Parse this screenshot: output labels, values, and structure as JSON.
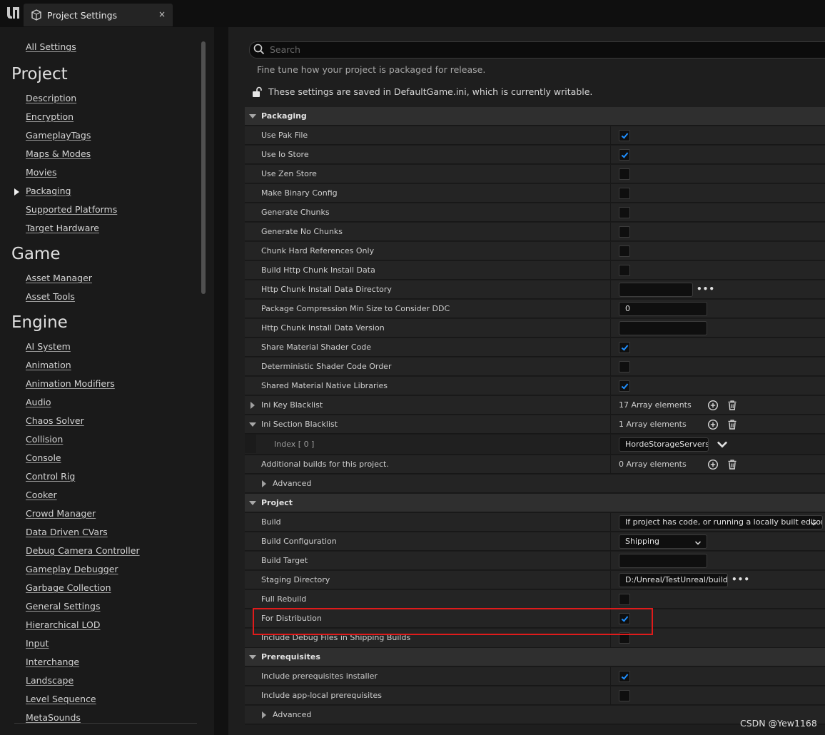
{
  "window": {
    "tab_title": "Project Settings",
    "close_glyph": "×"
  },
  "nav": {
    "all_settings": "All Settings",
    "sections": [
      {
        "heading": "Project",
        "items": [
          "Description",
          "Encryption",
          "GameplayTags",
          "Maps & Modes",
          "Movies",
          "Packaging",
          "Supported Platforms",
          "Target Hardware"
        ],
        "selected": "Packaging"
      },
      {
        "heading": "Game",
        "items": [
          "Asset Manager",
          "Asset Tools"
        ]
      },
      {
        "heading": "Engine",
        "items": [
          "AI System",
          "Animation",
          "Animation Modifiers",
          "Audio",
          "Chaos Solver",
          "Collision",
          "Console",
          "Control Rig",
          "Cooker",
          "Crowd Manager",
          "Data Driven CVars",
          "Debug Camera Controller",
          "Gameplay Debugger",
          "Garbage Collection",
          "General Settings",
          "Hierarchical LOD",
          "Input",
          "Interchange",
          "Landscape",
          "Level Sequence",
          "MetaSounds"
        ]
      }
    ]
  },
  "search": {
    "placeholder": "Search",
    "value": ""
  },
  "description": "Fine tune how your project is packaged for release.",
  "writable_note": "These settings are saved in DefaultGame.ini, which is currently writable.",
  "categories": {
    "packaging": "Packaging",
    "project": "Project",
    "prerequisites": "Prerequisites"
  },
  "packaging": {
    "use_pak_file": {
      "label": "Use Pak File",
      "checked": true
    },
    "use_io_store": {
      "label": "Use Io Store",
      "checked": true
    },
    "use_zen_store": {
      "label": "Use Zen Store",
      "checked": false
    },
    "make_binary_config": {
      "label": "Make Binary Config",
      "checked": false
    },
    "generate_chunks": {
      "label": "Generate Chunks",
      "checked": false
    },
    "generate_no_chunks": {
      "label": "Generate No Chunks",
      "checked": false
    },
    "chunk_hard_refs": {
      "label": "Chunk Hard References Only",
      "checked": false
    },
    "build_http_chunk": {
      "label": "Build Http Chunk Install Data",
      "checked": false
    },
    "http_chunk_dir": {
      "label": "Http Chunk Install Data Directory",
      "value": ""
    },
    "compression_min_size": {
      "label": "Package Compression Min Size to Consider DDC",
      "value": "0"
    },
    "http_chunk_version": {
      "label": "Http Chunk Install Data Version",
      "value": ""
    },
    "share_material_shader": {
      "label": "Share Material Shader Code",
      "checked": true
    },
    "deterministic_shader": {
      "label": "Deterministic Shader Code Order",
      "checked": false
    },
    "shared_native_libs": {
      "label": "Shared Material Native Libraries",
      "checked": true
    },
    "ini_key_blacklist": {
      "label": "Ini Key Blacklist",
      "count": "17 Array elements"
    },
    "ini_section_blacklist": {
      "label": "Ini Section Blacklist",
      "count": "1 Array elements"
    },
    "index0": {
      "label": "Index [ 0 ]",
      "value": "HordeStorageServers"
    },
    "additional_builds": {
      "label": "Additional builds for this project.",
      "count": "0 Array elements"
    },
    "advanced": "Advanced"
  },
  "project": {
    "build": {
      "label": "Build",
      "value": "If project has code, or running a locally built editor"
    },
    "build_configuration": {
      "label": "Build Configuration",
      "value": "Shipping"
    },
    "build_target": {
      "label": "Build Target",
      "value": ""
    },
    "staging_directory": {
      "label": "Staging Directory",
      "value": "D:/Unreal/TestUnreal/build"
    },
    "full_rebuild": {
      "label": "Full Rebuild",
      "checked": false
    },
    "for_distribution": {
      "label": "For Distribution",
      "checked": true
    },
    "include_debug_files": {
      "label": "Include Debug Files in Shipping Builds",
      "checked": false
    }
  },
  "prerequisites": {
    "installer": {
      "label": "Include prerequisites installer",
      "checked": true
    },
    "app_local": {
      "label": "Include app-local prerequisites",
      "checked": false
    },
    "advanced": "Advanced"
  },
  "watermark": "CSDN @Yew1168",
  "colors": {
    "accent": "#1f8fff",
    "highlight": "#e01b1b",
    "background": "#1a1a1a"
  }
}
